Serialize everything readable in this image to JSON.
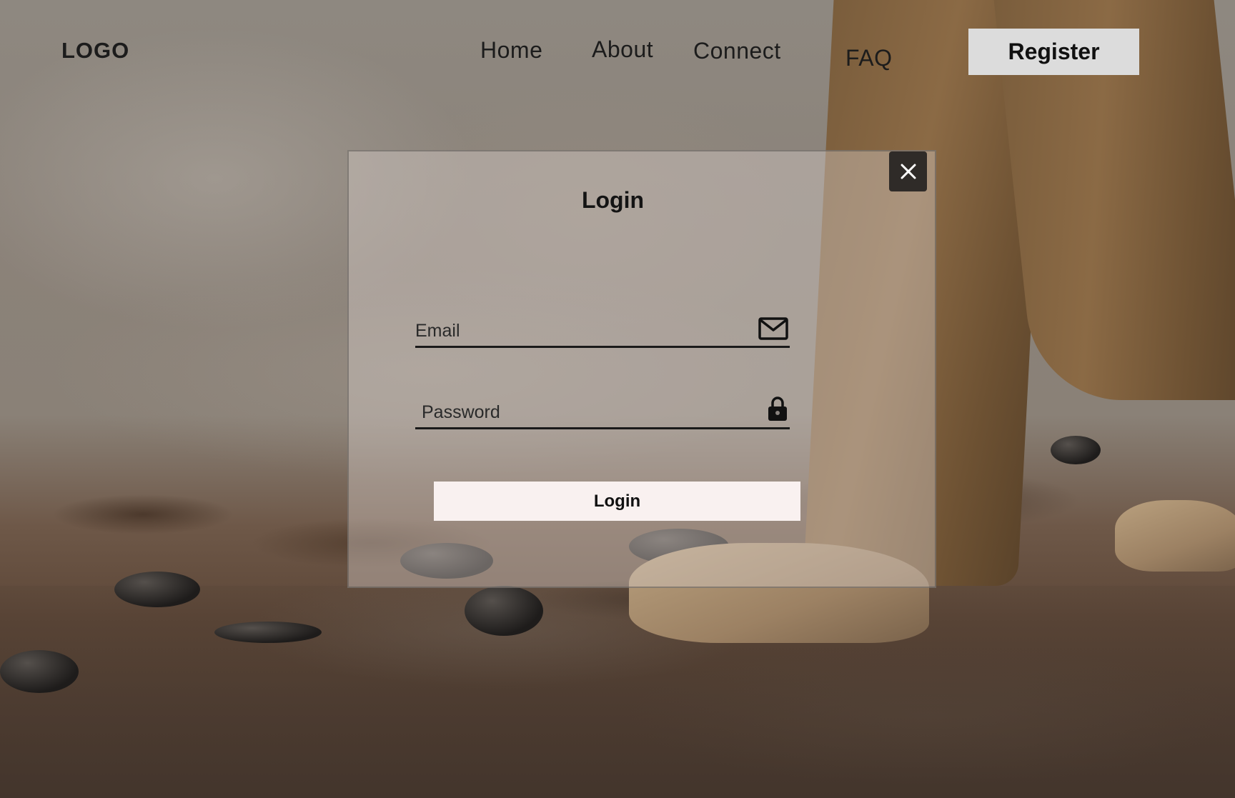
{
  "header": {
    "logo": "LOGO",
    "nav": {
      "home": "Home",
      "about": "About",
      "connect": "Connect",
      "faq": "FAQ"
    },
    "register_label": "Register"
  },
  "modal": {
    "title": "Login",
    "email": {
      "placeholder": "Email",
      "value": "",
      "icon": "mail-icon"
    },
    "password": {
      "placeholder": "Password",
      "value": "",
      "icon": "lock-icon"
    },
    "submit_label": "Login",
    "close_icon": "close-icon"
  },
  "colors": {
    "register_button_bg": "#dcdcdc",
    "login_button_bg": "#f9f1f0",
    "close_button_bg": "#2f2b28",
    "text": "#1c1c1c"
  }
}
